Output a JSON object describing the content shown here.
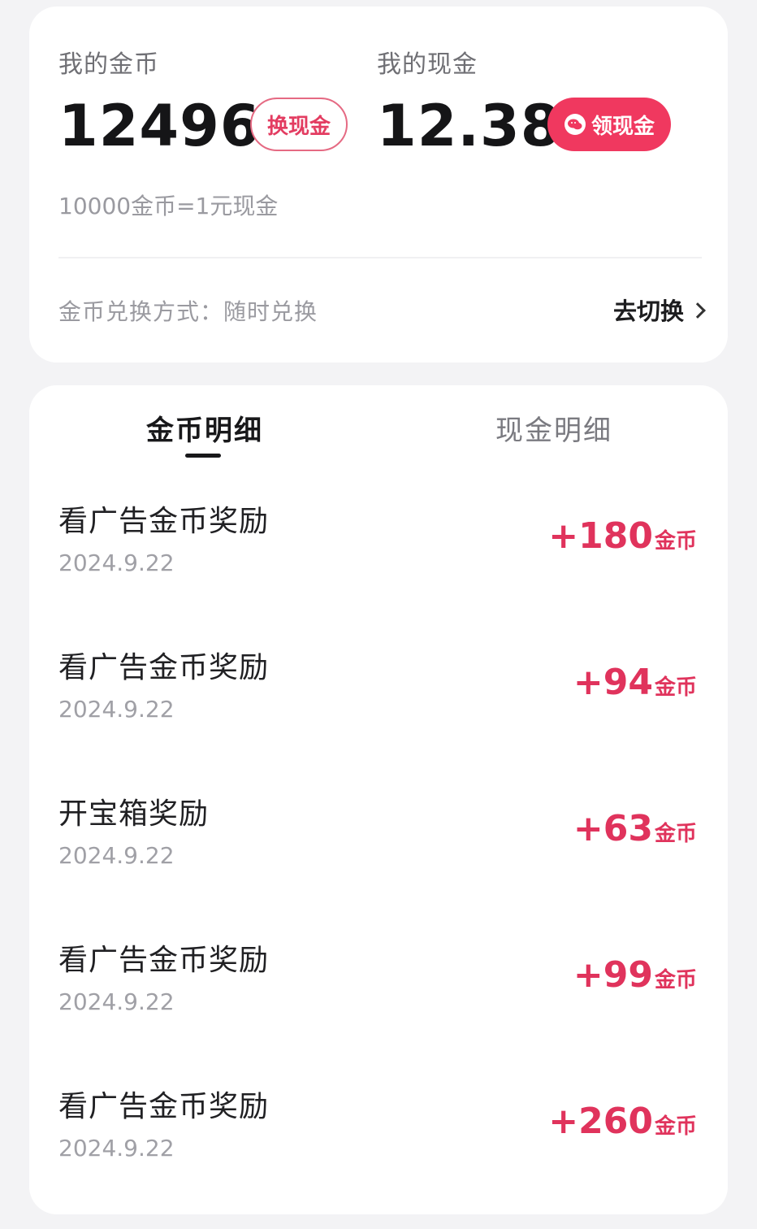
{
  "wallet": {
    "coins_label": "我的金币",
    "coins_value": "12496",
    "exchange_button": "换现金",
    "cash_label": "我的现金",
    "cash_value": "12.38",
    "withdraw_button": "领现金",
    "rate_text": "10000金币=1元现金",
    "method_text": "金币兑换方式：随时兑换",
    "switch_label": "去切换",
    "accent_color": "#f0385f"
  },
  "tabs": [
    {
      "label": "金币明细",
      "active": true
    },
    {
      "label": "现金明细",
      "active": false
    }
  ],
  "records": [
    {
      "title": "看广告金币奖励",
      "date": "2024.9.22",
      "amount": "+180",
      "unit": "金币"
    },
    {
      "title": "看广告金币奖励",
      "date": "2024.9.22",
      "amount": "+94",
      "unit": "金币"
    },
    {
      "title": "开宝箱奖励",
      "date": "2024.9.22",
      "amount": "+63",
      "unit": "金币"
    },
    {
      "title": "看广告金币奖励",
      "date": "2024.9.22",
      "amount": "+99",
      "unit": "金币"
    },
    {
      "title": "看广告金币奖励",
      "date": "2024.9.22",
      "amount": "+260",
      "unit": "金币"
    }
  ]
}
